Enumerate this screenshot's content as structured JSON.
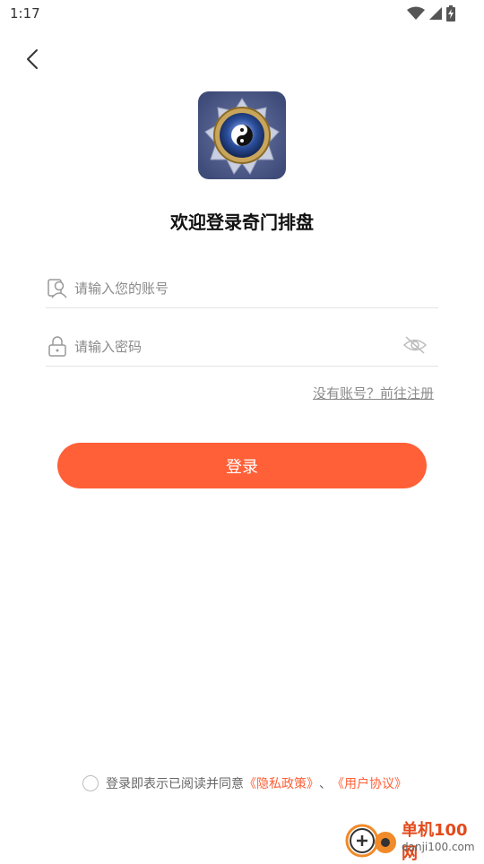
{
  "status_bar": {
    "time": "1:17"
  },
  "welcome": {
    "title": "欢迎登录奇门排盘"
  },
  "account": {
    "placeholder": "请输入您的账号",
    "value": ""
  },
  "password": {
    "placeholder": "请输入密码",
    "value": ""
  },
  "register": {
    "label": "没有账号？前往注册"
  },
  "login": {
    "label": "登录"
  },
  "agreement": {
    "prefix": "登录即表示已阅读并同意",
    "privacy": "《隐私政策》",
    "separator": "、",
    "terms": "《用户协议》"
  },
  "watermark": {
    "brand": "单机100网",
    "domain": "danji100.com"
  },
  "colors": {
    "accent": "#ff6038",
    "divider": "#e3e3e3",
    "hint": "#8a8a8a"
  }
}
